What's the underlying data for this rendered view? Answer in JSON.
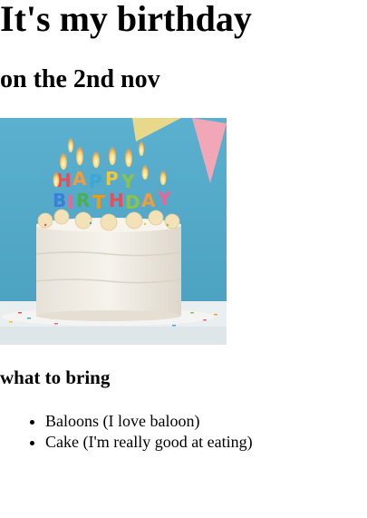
{
  "page": {
    "heading": "It's my birthday",
    "subheading": "on the 2nd nov",
    "image": {
      "subject": "birthday-cake-photo",
      "candle_letters": [
        "H",
        "A",
        "P",
        "P",
        "Y",
        "B",
        "I",
        "R",
        "T",
        "H",
        "D",
        "A",
        "Y"
      ]
    },
    "section_title": "what to bring",
    "bring_list": [
      "Baloons (I love baloon)",
      "Cake (I'm really good at eating)"
    ]
  },
  "colors": {
    "background_photo": "#4fa8c7",
    "cake_frosting": "#f3efe7",
    "table": "#e8eef0",
    "pennant_yellow": "#e8d98a",
    "pennant_pink": "#f2a7b8"
  }
}
